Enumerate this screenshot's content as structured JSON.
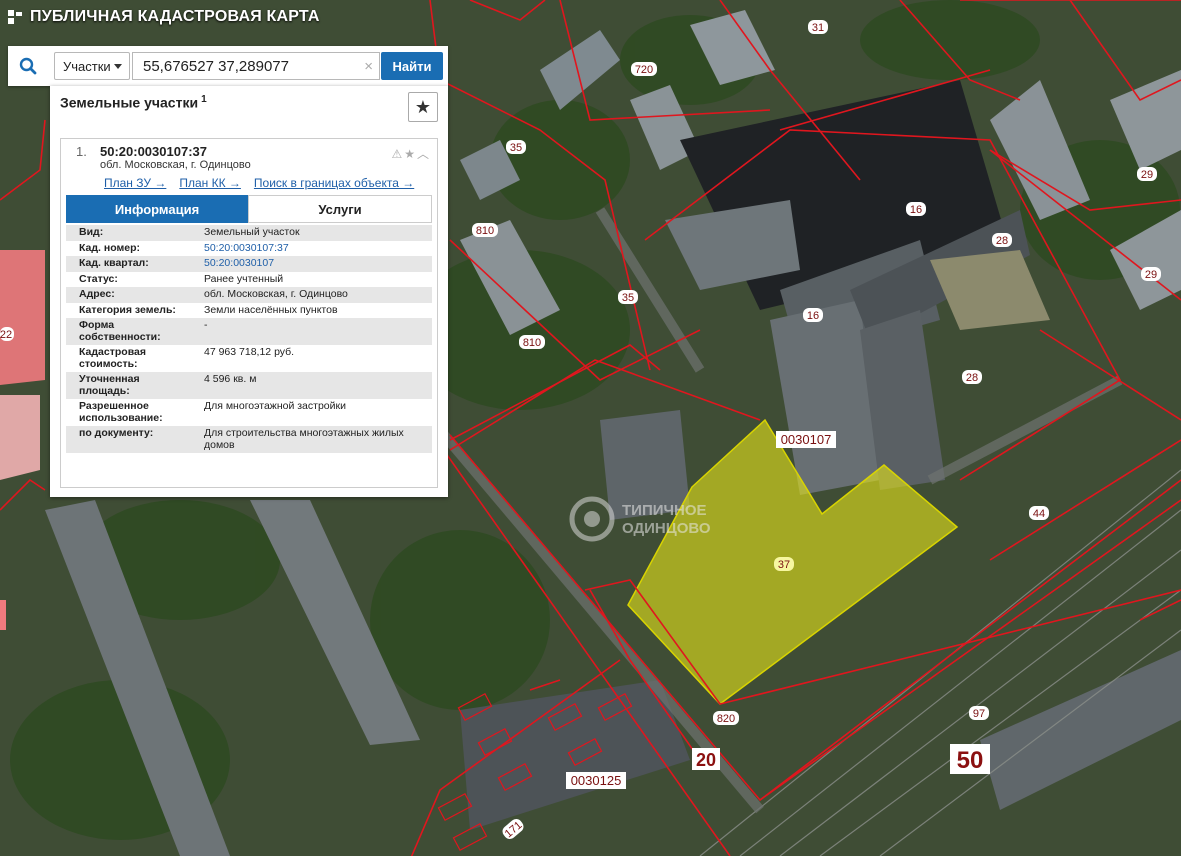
{
  "app": {
    "title": "ПУБЛИЧНАЯ КАДАСТРОВАЯ КАРТА"
  },
  "search": {
    "type_label": "Участки",
    "query": "55,676527 37,289077",
    "clear": "×",
    "find_label": "Найти"
  },
  "results": {
    "header": "Земельные участки",
    "count": "1",
    "item": {
      "index": "1.",
      "cad_number": "50:20:0030107:37",
      "address": "обл. Московская, г. Одинцово",
      "links": [
        "План ЗУ →",
        "План КК →",
        "Поиск в границах объекта →"
      ],
      "tabs": [
        "Информация",
        "Услуги"
      ],
      "attributes": [
        {
          "key": "Вид:",
          "value": "Земельный участок"
        },
        {
          "key": "Кад. номер:",
          "value": "50:20:0030107:37"
        },
        {
          "key": "Кад. квартал:",
          "value": "50:20:0030107"
        },
        {
          "key": "Статус:",
          "value": "Ранее учтенный"
        },
        {
          "key": "Адрес:",
          "value": "обл. Московская, г. Одинцово"
        },
        {
          "key": "Категория земель:",
          "value": "Земли населённых пунктов"
        },
        {
          "key": "Форма собственности:",
          "value": "-"
        },
        {
          "key": "Кадастровая стоимость:",
          "value": "47 963 718,12 руб."
        },
        {
          "key": "Уточненная площадь:",
          "value": "4 596 кв. м"
        },
        {
          "key": "Разрешенное использование:",
          "value": "Для многоэтажной застройки"
        },
        {
          "key": "по документу:",
          "value": "Для строительства многоэтажных жилых домов"
        }
      ]
    }
  },
  "map": {
    "labels": {
      "l31": "31",
      "l720a": "720",
      "l35a": "35",
      "l35b": "35",
      "l810a": "810",
      "l810b": "810",
      "l16a": "16",
      "l16b": "16",
      "l28a": "28",
      "l28b": "28",
      "l29a": "29",
      "l29b": "29",
      "l22": "22",
      "l30107": "0030107",
      "l37": "37",
      "l44": "44",
      "l820": "820",
      "l97": "97",
      "l20": "20",
      "l50": "50",
      "l30125": "0030125",
      "l171": "171"
    },
    "watermark": [
      "ТИПИЧНОЕ",
      "ОДИНЦОВО"
    ],
    "colors": {
      "boundary": "#e0161e",
      "parcel_fill": "#e6e619",
      "accent": "#1a6db3"
    }
  }
}
